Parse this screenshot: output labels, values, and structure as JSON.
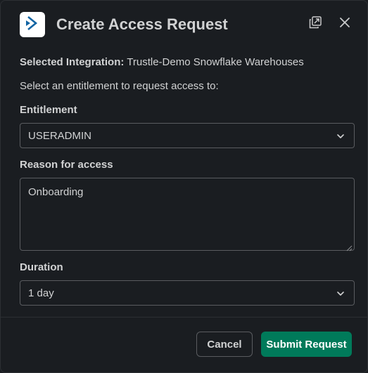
{
  "header": {
    "title": "Create Access Request",
    "logo_icon": "arrow-chevron-logo-icon",
    "logo_color": "#1264a3",
    "expand_icon": "open-in-window-icon",
    "close_icon": "close-icon"
  },
  "integration": {
    "label": "Selected Integration:",
    "value": "Trustle-Demo Snowflake Warehouses"
  },
  "prompt": "Select an entitlement to request access to:",
  "entitlement": {
    "label": "Entitlement",
    "selected": "USERADMIN"
  },
  "reason": {
    "label": "Reason for access",
    "value": "Onboarding"
  },
  "duration": {
    "label": "Duration",
    "selected": "1 day"
  },
  "footer": {
    "cancel_label": "Cancel",
    "submit_label": "Submit Request",
    "submit_color": "#007a5a"
  }
}
